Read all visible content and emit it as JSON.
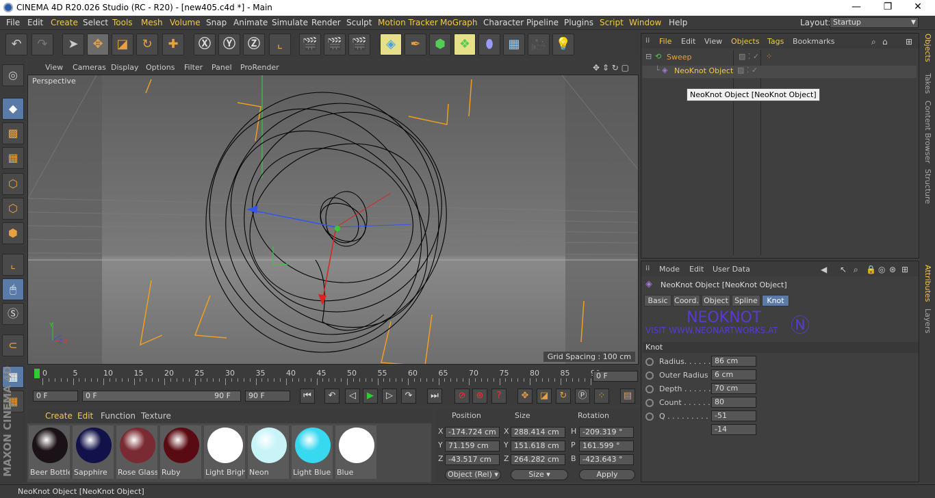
{
  "titlebar": {
    "title": "CINEMA 4D R20.026 Studio (RC - R20) - [new405.c4d *] - Main",
    "minimize": "—",
    "maximize": "❐",
    "close": "✕"
  },
  "menu": [
    "File",
    "Edit",
    "Create",
    "Select",
    "Tools",
    "Mesh",
    "Volume",
    "Snap",
    "Animate",
    "Simulate",
    "Render",
    "Sculpt",
    "Motion Tracker",
    "MoGraph",
    "Character",
    "Pipeline",
    "Plugins",
    "Script",
    "Window",
    "Help"
  ],
  "layout": {
    "label": "Layout:",
    "value": "Startup"
  },
  "viewport": {
    "menu": [
      "View",
      "Cameras",
      "Display",
      "Options",
      "Filter",
      "Panel",
      "ProRender"
    ],
    "camera": "Perspective",
    "grid_spacing": "Grid Spacing : 100 cm"
  },
  "timeline": {
    "ticks": [
      "0",
      "5",
      "10",
      "15",
      "20",
      "25",
      "30",
      "35",
      "40",
      "45",
      "50",
      "55",
      "60",
      "65",
      "70",
      "75",
      "80",
      "85",
      "90"
    ],
    "current": "0 F",
    "start": "0 F",
    "range_start": "0 F",
    "range_end": "90 F",
    "end": "90 F"
  },
  "materials": {
    "menu": [
      "Create",
      "Edit",
      "Function",
      "Texture"
    ],
    "items": [
      {
        "name": "Beer Bottle",
        "color": "#1a1216"
      },
      {
        "name": "Sapphire",
        "color": "#12124a"
      },
      {
        "name": "Rose Glass",
        "color": "#7a2a32"
      },
      {
        "name": "Ruby",
        "color": "#5a0a12"
      },
      {
        "name": "Light Brigh",
        "color": "#ffffff"
      },
      {
        "name": "Neon",
        "color": "#c8f4f8"
      },
      {
        "name": "Light Blue",
        "color": "#38d8f0"
      },
      {
        "name": "Blue",
        "color": "#ffffff"
      }
    ]
  },
  "coordinates": {
    "headers": {
      "position": "Position",
      "size": "Size",
      "rotation": "Rotation"
    },
    "rows": [
      {
        "axis": "X",
        "pos": "-174.724 cm",
        "saxis": "X",
        "size": "288.414 cm",
        "raxis": "H",
        "rot": "-209.319 °"
      },
      {
        "axis": "Y",
        "pos": "71.159 cm",
        "saxis": "Y",
        "size": "151.618 cm",
        "raxis": "P",
        "rot": "161.599 °"
      },
      {
        "axis": "Z",
        "pos": "-43.517 cm",
        "saxis": "Z",
        "size": "264.282 cm",
        "raxis": "B",
        "rot": "-423.643 °"
      }
    ],
    "mode": "Object (Rel)",
    "size_mode": "Size",
    "apply": "Apply"
  },
  "objects": {
    "menu": [
      "File",
      "Edit",
      "View",
      "Objects",
      "Tags",
      "Bookmarks"
    ],
    "items": [
      {
        "name": "Sweep"
      },
      {
        "name": "NeoKnot Object"
      }
    ],
    "tooltip": "NeoKnot Object [NeoKnot Object]"
  },
  "attributes": {
    "menu": [
      "Mode",
      "Edit",
      "User Data"
    ],
    "object_title": "NeoKnot Object [NeoKnot Object]",
    "tabs": [
      "Basic",
      "Coord.",
      "Object",
      "Spline",
      "Knot"
    ],
    "banner_title": "NEOKNOT",
    "banner_sub": "VISIT WWW.NEONARTWORKS.AT",
    "section": "Knot",
    "params": [
      {
        "label": "Radius. . . . . .",
        "value": "86 cm"
      },
      {
        "label": "Outer Radius",
        "value": "6 cm"
      },
      {
        "label": "Depth . . . . . .",
        "value": "70 cm"
      },
      {
        "label": "Count . . . . . .",
        "value": "80"
      },
      {
        "label": "Q . . . . . . . . . .",
        "value": "-51"
      },
      {
        "label": "",
        "value": "-14"
      }
    ]
  },
  "right_tabs": [
    "Objects",
    "Takes",
    "Content Browser",
    "Structure",
    "Attributes",
    "Layers"
  ],
  "brand": "MAXON CINEMA 4D",
  "status": "NeoKnot Object [NeoKnot Object]",
  "colors": {
    "accent": "#f2c94c",
    "tab_active": "#5a7aa8",
    "icon_orange": "#e8a040"
  }
}
